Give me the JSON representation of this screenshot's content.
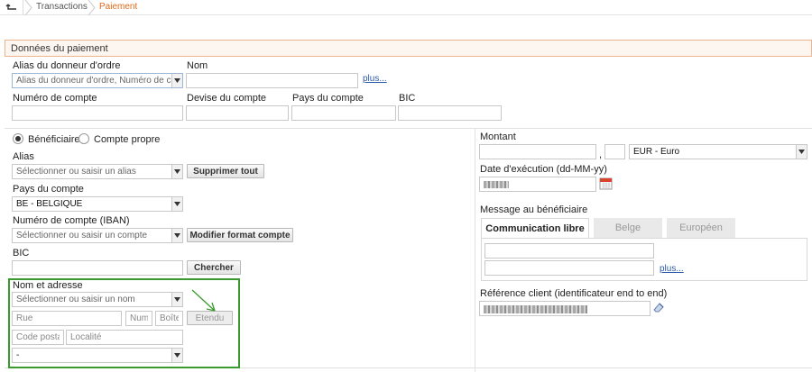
{
  "breadcrumb": {
    "items": [
      "Transactions",
      "Paiement"
    ]
  },
  "section": {
    "title": "Données du paiement"
  },
  "donor": {
    "alias_label": "Alias du donneur d'ordre",
    "alias_placeholder": "Alias du donneur d'ordre, Numéro de compte",
    "name_label": "Nom",
    "more_link": "plus...",
    "account_label": "Numéro de compte",
    "currency_label": "Devise du compte",
    "country_label": "Pays du compte",
    "bic_label": "BIC"
  },
  "beneficiary": {
    "radio_beneficiary": "Bénéficiaire",
    "radio_own_account": "Compte propre",
    "alias_label": "Alias",
    "alias_placeholder": "Sélectionner ou saisir un alias",
    "delete_all_button": "Supprimer tout",
    "country_label": "Pays du compte",
    "country_value": "BE - BELGIQUE",
    "iban_label": "Numéro de compte (IBAN)",
    "iban_placeholder": "Sélectionner ou saisir un compte",
    "modify_format_button": "Modifier format compte",
    "bic_label": "BIC",
    "search_button": "Chercher",
    "name_address_label": "Nom et adresse",
    "name_placeholder": "Sélectionner ou saisir un nom",
    "street_placeholder": "Rue",
    "number_placeholder": "Numé",
    "box_placeholder": "Boîte",
    "extended_button": "Etendu",
    "postal_placeholder": "Code postal",
    "locality_placeholder": "Localité",
    "country_select_value": "-"
  },
  "amount": {
    "label": "Montant",
    "separator": ",",
    "currency_value": "EUR - Euro",
    "date_label": "Date d'exécution (dd-MM-yy)"
  },
  "message": {
    "label": "Message au bénéficiaire",
    "tabs": [
      "Communication libre",
      "Belge",
      "Européen"
    ],
    "more_link": "plus..."
  },
  "reference": {
    "label": "Référence client (identificateur end to end)"
  }
}
